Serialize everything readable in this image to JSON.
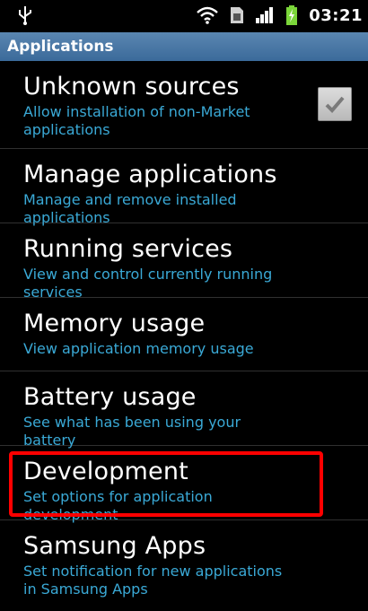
{
  "status_bar": {
    "time": "03:21",
    "icons": [
      "usb-icon",
      "wifi-icon",
      "sim-icon",
      "signal-icon",
      "battery-charging-icon"
    ]
  },
  "header": {
    "title": "Applications"
  },
  "settings": [
    {
      "title": "Unknown sources",
      "subtitle": "Allow installation of non-Market applications",
      "checkbox": true,
      "checked": true
    },
    {
      "title": "Manage applications",
      "subtitle": "Manage and remove installed applications"
    },
    {
      "title": "Running services",
      "subtitle": "View and control currently running services"
    },
    {
      "title": "Memory usage",
      "subtitle": "View application memory usage"
    },
    {
      "title": "Battery usage",
      "subtitle": "See what has been using your battery"
    },
    {
      "title": "Development",
      "subtitle": "Set options for application development",
      "highlighted": true
    },
    {
      "title": "Samsung Apps",
      "subtitle": "Set notification for new applications in Samsung Apps"
    }
  ],
  "colors": {
    "header_bg": "#4a79a8",
    "subtitle": "#3aa9d6",
    "highlight_border": "#ff0000",
    "battery": "#7bd63a"
  }
}
